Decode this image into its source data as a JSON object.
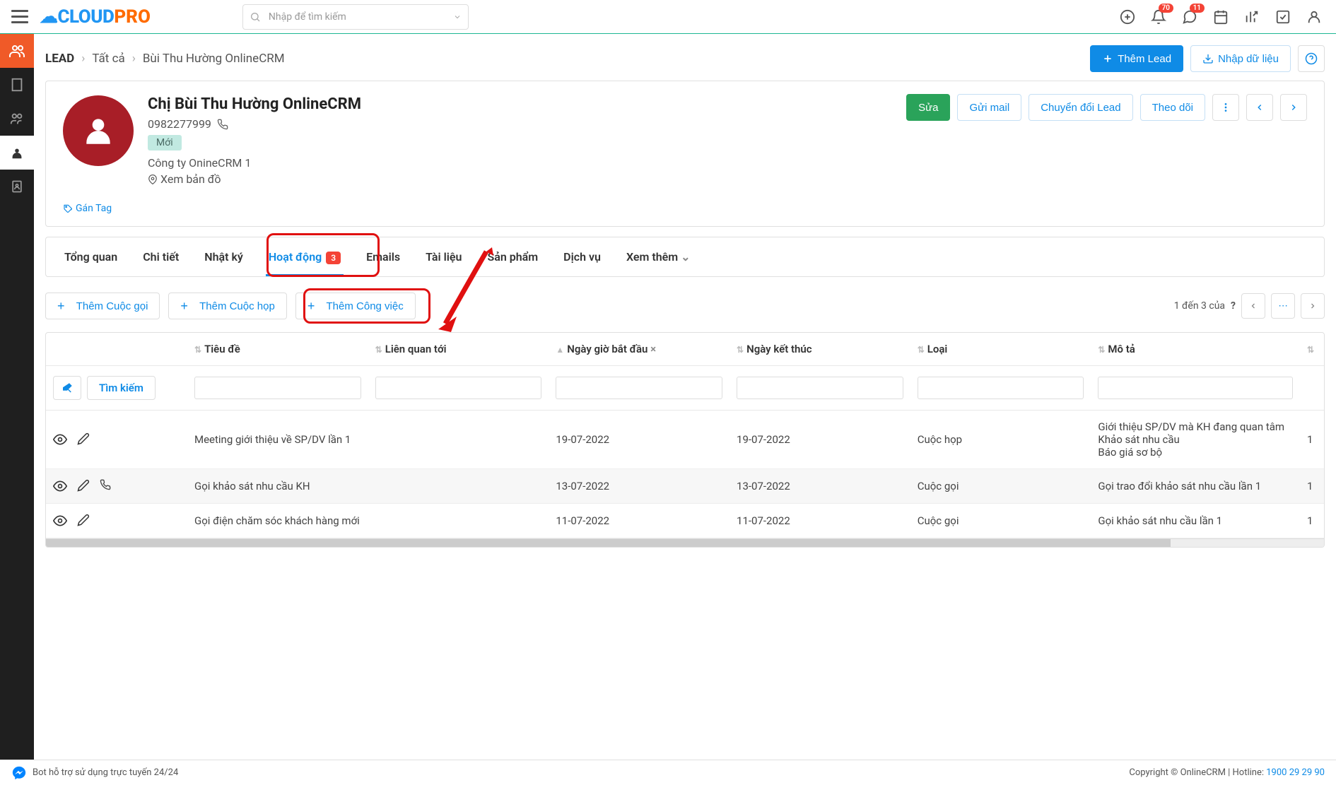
{
  "header": {
    "search_placeholder": "Nhập để tìm kiếm",
    "badges": {
      "bell": "70",
      "chat": "11"
    }
  },
  "breadcrumb": {
    "root": "LEAD",
    "mid": "Tất cả",
    "leaf": "Bùi Thu Hường OnlineCRM"
  },
  "breadcrumb_actions": {
    "add_lead": "Thêm Lead",
    "import": "Nhập dữ liệu"
  },
  "profile": {
    "title": "Chị Bùi Thu Hường OnlineCRM",
    "phone": "0982277999",
    "status": "Mới",
    "company": "Công ty OnineCRM 1",
    "map": "Xem bản đồ",
    "tag": "Gán Tag",
    "actions": {
      "edit": "Sửa",
      "mail": "Gửi mail",
      "convert": "Chuyển đổi Lead",
      "follow": "Theo dõi"
    }
  },
  "tabs": {
    "overview": "Tổng quan",
    "detail": "Chi tiết",
    "log": "Nhật ký",
    "activity": "Hoạt động",
    "activity_count": "3",
    "emails": "Emails",
    "docs": "Tài liệu",
    "products": "Sản phẩm",
    "services": "Dịch vụ",
    "more": "Xem thêm"
  },
  "add_buttons": {
    "call": "Thêm Cuộc gọi",
    "meeting": "Thêm Cuộc họp",
    "todo": "Thêm Công việc"
  },
  "pager": {
    "label": "1 đến 3 của",
    "unknown": "?"
  },
  "table": {
    "columns": {
      "title": "Tiêu đề",
      "related": "Liên quan tới",
      "start": "Ngày giờ bắt đầu",
      "end": "Ngày kết thúc",
      "type": "Loại",
      "desc": "Mô tả"
    },
    "search": "Tìm kiếm",
    "rows": [
      {
        "title": "Meeting giới thiệu về SP/DV lần 1",
        "start": "19-07-2022",
        "end": "19-07-2022",
        "type": "Cuộc họp",
        "desc": "Giới thiệu SP/DV mà KH đang quan tâm\nKhảo sát nhu cầu\nBáo giá sơ bộ",
        "hasPhone": false
      },
      {
        "title": "Gọi khảo sát nhu cầu KH",
        "start": "13-07-2022",
        "end": "13-07-2022",
        "type": "Cuộc gọi",
        "desc": "Gọi trao đổi khảo sát nhu cầu lần 1",
        "hasPhone": true
      },
      {
        "title": "Gọi điện chăm sóc khách hàng mới",
        "start": "11-07-2022",
        "end": "11-07-2022",
        "type": "Cuộc gọi",
        "desc": "Gọi khảo sát nhu cầu lần 1",
        "hasPhone": false
      }
    ]
  },
  "footer": {
    "bot": "Bot hỗ trợ sử dụng trực tuyến 24/24",
    "copyright": "Copyright © OnlineCRM | Hotline: ",
    "hotline": "1900 29 29 90"
  }
}
